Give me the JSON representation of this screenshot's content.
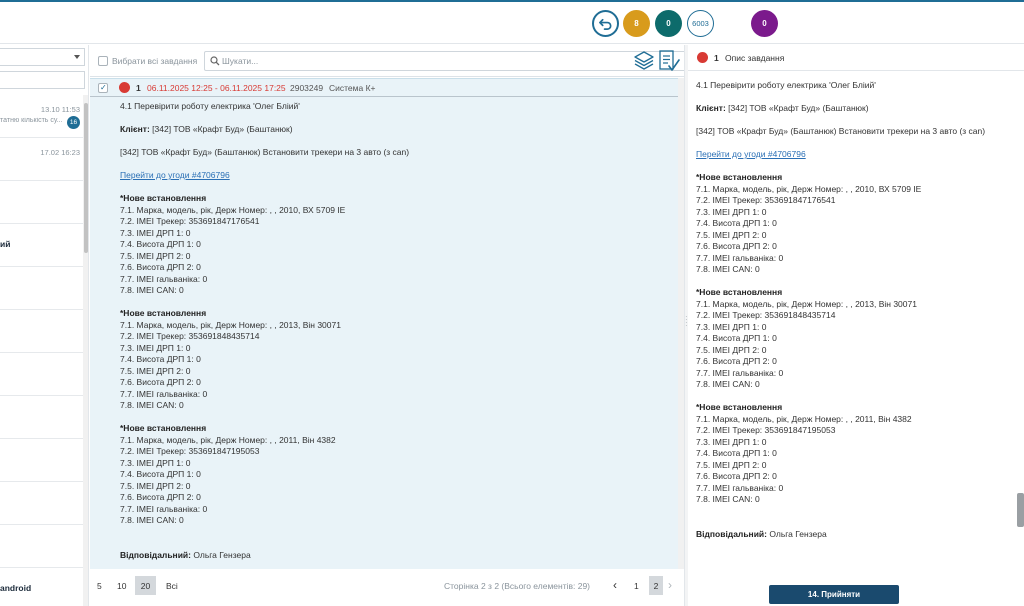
{
  "topbar": {
    "counters": [
      {
        "label": "8",
        "color": "#d89b1c"
      },
      {
        "label": "0",
        "color": "#0d6b6b"
      },
      {
        "label": "6003",
        "color": "#1f6d95"
      },
      {
        "label": "0",
        "color": "#7b1a8c"
      }
    ]
  },
  "sidebar": {
    "rows": [
      {
        "date": "13.10 11:53",
        "snippet": "татню кількість су...",
        "count": "16"
      },
      {
        "date": "17.02 16:23",
        "snippet": ""
      },
      {
        "bold": ""
      },
      {
        "bold": "ий"
      },
      {
        "bold": ""
      },
      {
        "bold": ""
      },
      {
        "bold": ""
      },
      {
        "bold": ""
      },
      {
        "bold": ""
      },
      {
        "bold": ""
      },
      {
        "bold": ""
      },
      {
        "bold": "android"
      }
    ]
  },
  "middle": {
    "select_all_label": "Вибрати всі завдання",
    "search_placeholder": "Шукати...",
    "task": {
      "number": "1",
      "dates": "06.11.2025 12:25 - 06.11.2025 17:25",
      "id": "2903249",
      "system": "Система К+"
    },
    "pager": {
      "sizes": [
        "5",
        "10",
        "20",
        "Всі"
      ],
      "selected_size": "20",
      "info": "Сторінка 2 з 2 (Всього елементів: 29)",
      "pages": [
        "1",
        "2"
      ]
    }
  },
  "task_content": {
    "title": "4.1 Перевірити роботу електрика 'Олег Бліий'",
    "client_label": "Клієнт:",
    "client_value": "[342] ТОВ «Крафт Буд» (Баштанюк)",
    "summary": "[342] ТОВ «Крафт Буд» (Баштанюк) Встановити трекери на 3 авто (з can)",
    "deal_link": "Перейти до угоди #4706796",
    "installs": [
      {
        "header": "*Нове встановлення",
        "lines": [
          "7.1. Марка, модель, рік, Держ Номер: , , 2010, ВХ 5709 ІЕ",
          "7.2. IMEI Трекер: 353691847176541",
          "7.3. IMEI ДРП 1: 0",
          "7.4. Висота ДРП 1: 0",
          "7.5. IMEI ДРП 2: 0",
          "7.6. Висота ДРП 2: 0",
          "7.7. IMEI гальваніка: 0",
          "7.8. IMEI CAN: 0"
        ]
      },
      {
        "header": "*Нове встановлення",
        "lines": [
          "7.1. Марка, модель, рік, Держ Номер: , , 2013, Він 30071",
          "7.2. IMEI Трекер: 353691848435714",
          "7.3. IMEI ДРП 1: 0",
          "7.4. Висота ДРП 1: 0",
          "7.5. IMEI ДРП 2: 0",
          "7.6. Висота ДРП 2: 0",
          "7.7. IMEI гальваніка: 0",
          "7.8. IMEI CAN: 0"
        ]
      },
      {
        "header": "*Нове встановлення",
        "lines": [
          "7.1. Марка, модель, рік, Держ Номер: , , 2011, Він 4382",
          "7.2. IMEI Трекер: 353691847195053",
          "7.3. IMEI ДРП 1: 0",
          "7.4. Висота ДРП 1: 0",
          "7.5. IMEI ДРП 2: 0",
          "7.6. Висота ДРП 2: 0",
          "7.7. IMEI гальваніка: 0",
          "7.8. IMEI CAN: 0"
        ]
      }
    ],
    "responsible_label": "Відповідальний:",
    "responsible_value": "Ольга Гензера"
  },
  "right": {
    "number": "1",
    "title": "Опис завдання",
    "accept_label": "14. Прийняти"
  }
}
